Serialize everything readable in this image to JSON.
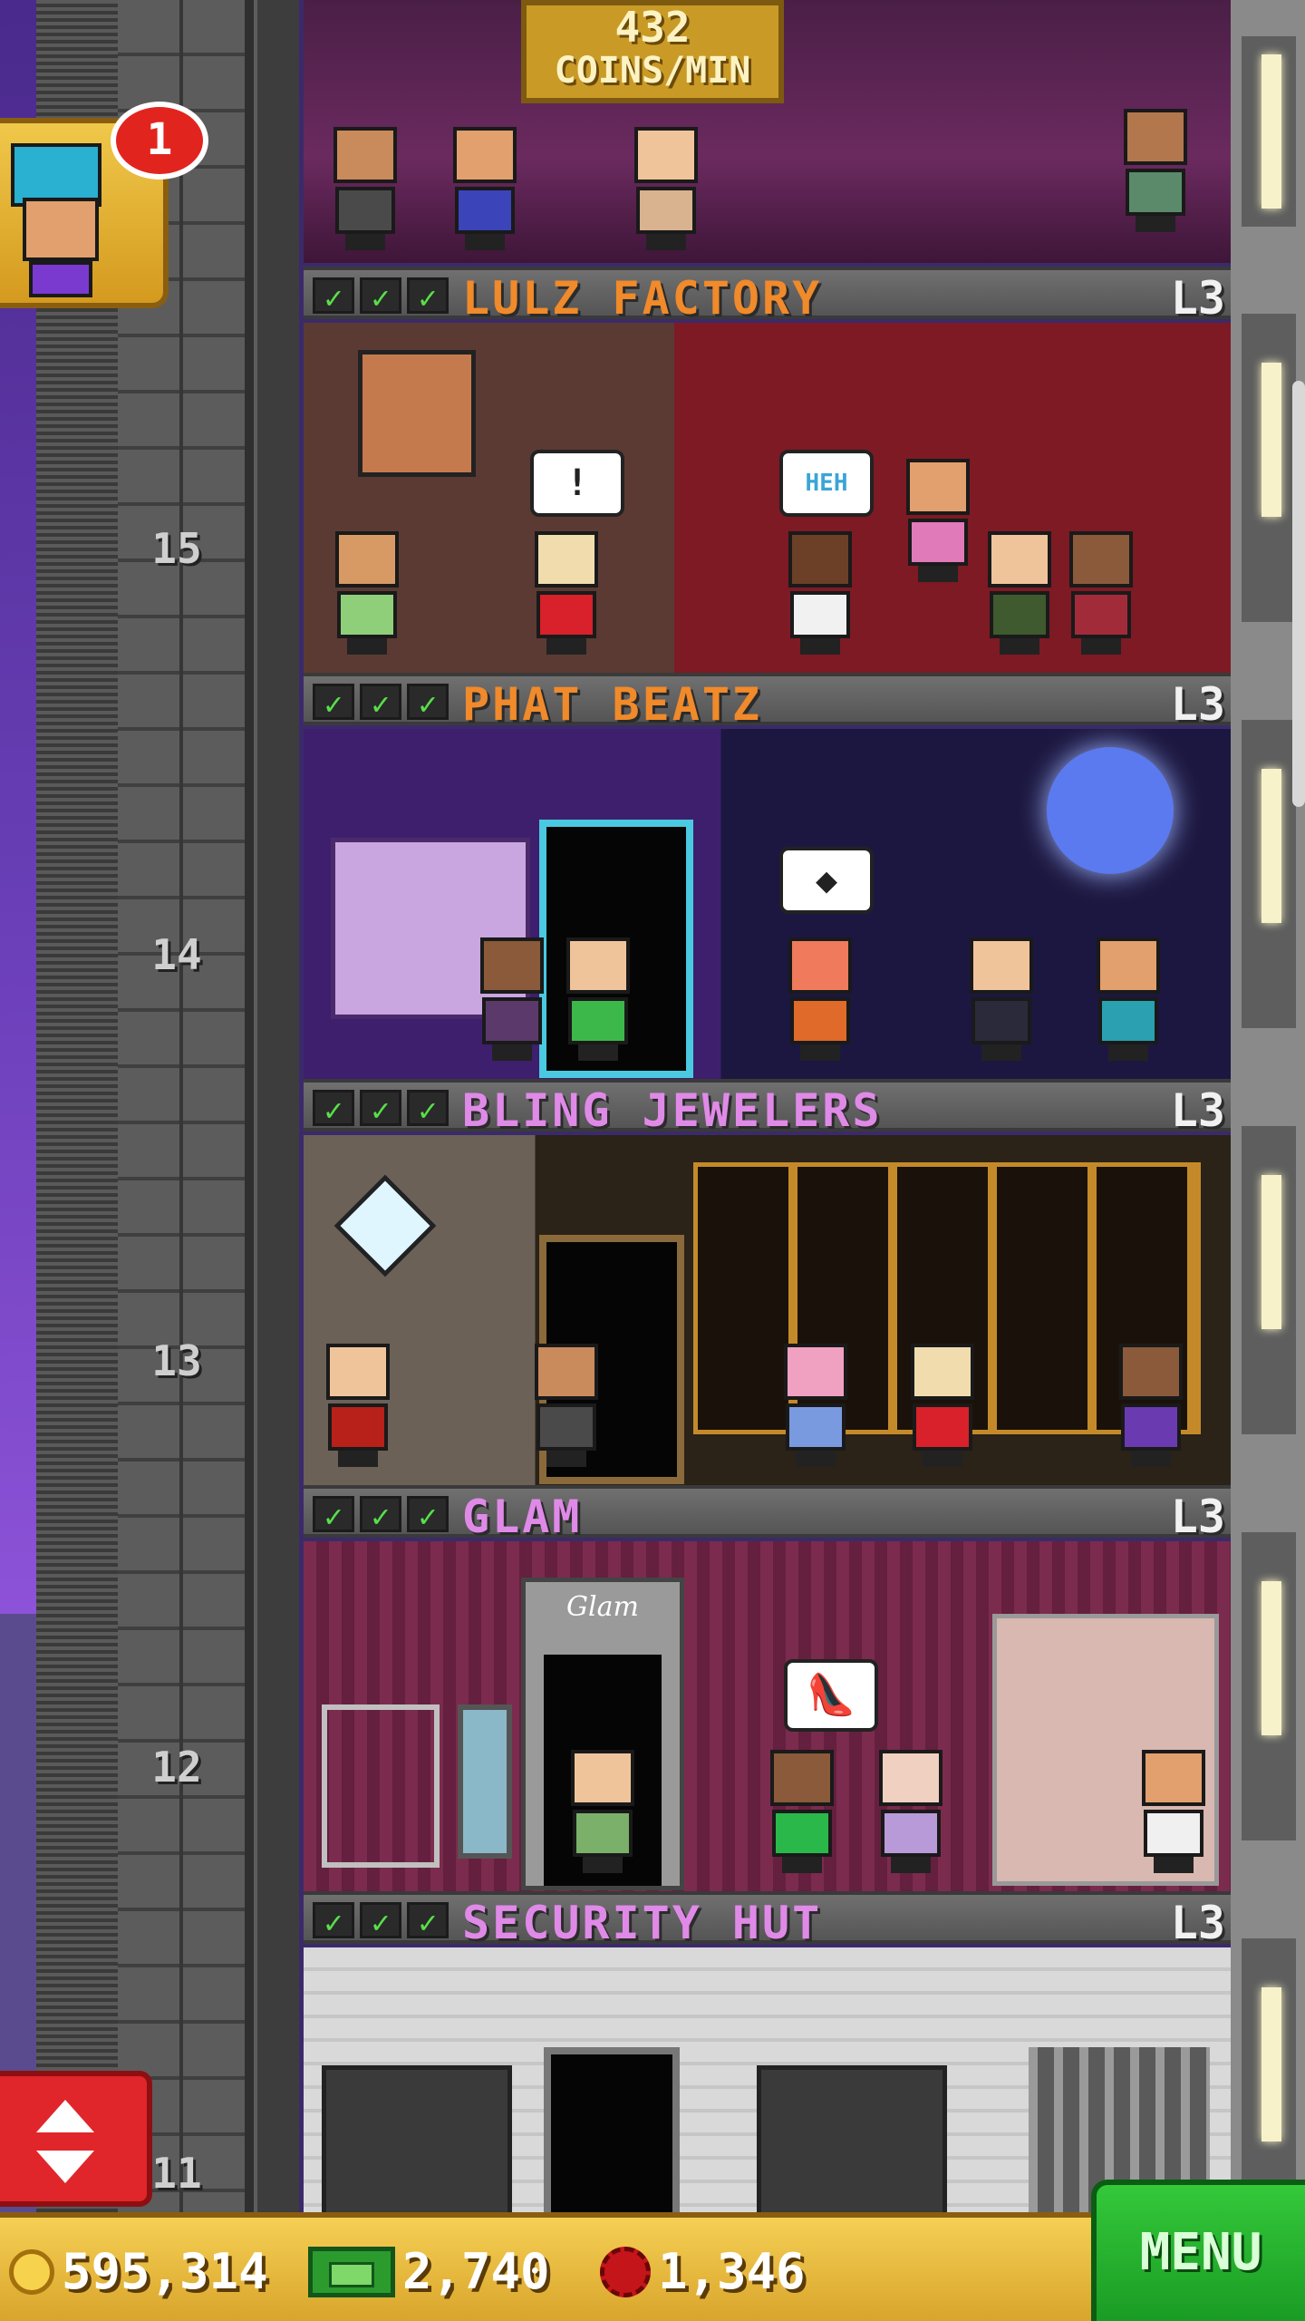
{
  "top_floor": {
    "coin_rate_value": "432",
    "coin_rate_unit": "COINS/MIN"
  },
  "visitor_notification": {
    "count": "1"
  },
  "floors": [
    {
      "name": "LULZ FACTORY",
      "level": "L3",
      "number": "15",
      "name_color": "#f08a2a",
      "bubble_left": "!",
      "bubble_right": "HEH"
    },
    {
      "name": "PHAT BEATZ",
      "level": "L3",
      "number": "14",
      "name_color": "#f08a2a",
      "bubble": "◆"
    },
    {
      "name": "BLING JEWELERS",
      "level": "L3",
      "number": "13",
      "name_color": "#e08ae8"
    },
    {
      "name": "GLAM",
      "level": "L3",
      "number": "12",
      "name_color": "#e08ae8",
      "store_sign": "Glam"
    },
    {
      "name": "SECURITY HUT",
      "level": "L3",
      "number": "11",
      "name_color": "#e08ae8"
    }
  ],
  "resources": {
    "coins": "595,314",
    "bux": "2,740",
    "gems": "1,346"
  },
  "menu": {
    "label": "MENU"
  },
  "icons": [
    "coin-icon",
    "bux-icon",
    "gem-icon",
    "elevator-arrows-icon",
    "check-icon"
  ],
  "colors": {
    "menu_green": "#1fae2a",
    "bar_gold": "#e8b93e",
    "check_green": "#58e04a",
    "badge_red": "#e2241f"
  }
}
